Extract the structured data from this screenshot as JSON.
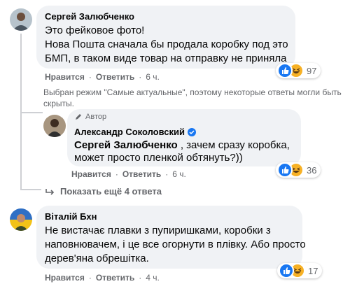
{
  "comments": [
    {
      "author": "Сергей Залюбченко",
      "lines": [
        "Это фейковое фото!",
        "Нова Пошта сначала бы продала коробку под это",
        "БМП, в таком виде товар на отправку не приняла"
      ],
      "like_label": "Нравится",
      "reply_label": "Ответить",
      "time": "6 ч.",
      "reactions": {
        "count": "97",
        "icons": [
          "like-icon",
          "haha-icon"
        ]
      }
    },
    {
      "badge": "Автор",
      "author": "Александр Соколовский",
      "mention": "Сергей Залюбченко",
      "line1_rest": " , зачем сразу коробка,",
      "line2": "может просто пленкой обтянуть?))",
      "like_label": "Нравится",
      "reply_label": "Ответить",
      "time": "6 ч.",
      "reactions": {
        "count": "36",
        "icons": [
          "like-icon",
          "haha-icon"
        ]
      }
    },
    {
      "author": "Віталій Бхн",
      "lines": [
        "Не вистачає плавки з пупиришками, коробки з",
        "наповнювачем, і це все огорнути в плівку. Або просто",
        "дерев'яна обрешітка."
      ],
      "like_label": "Нравится",
      "reply_label": "Ответить",
      "time": "4 ч.",
      "reactions": {
        "count": "17",
        "icons": [
          "like-icon",
          "haha-icon"
        ]
      }
    }
  ],
  "mode_note": {
    "line1": "Выбран режим \"Самые актуальные\", поэтому некоторые ответы могли быть",
    "line2": "скрыты."
  },
  "show_more": "Показать ещё 4 ответа",
  "colors": {
    "accent": "#1877f2",
    "bubble": "#f0f2f5",
    "meta": "#65676b"
  }
}
